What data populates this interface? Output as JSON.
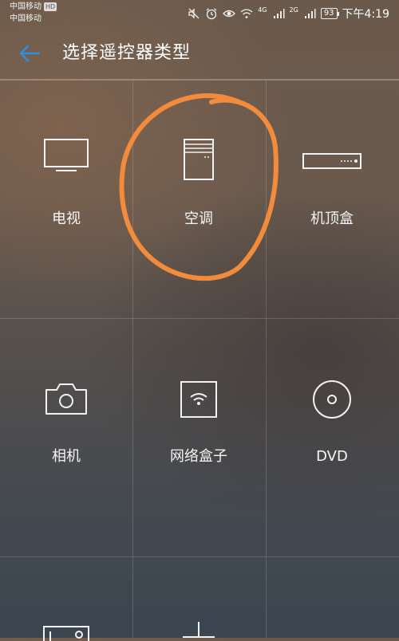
{
  "status_bar": {
    "carrier_1": "中国移动",
    "carrier_1_badge": "HD",
    "carrier_2": "中国移动",
    "network_1": "4G",
    "network_2": "2G",
    "battery": "93",
    "time": "下午4:19",
    "icons": [
      "mute-icon",
      "alarm-icon",
      "eye-icon",
      "wifi-icon",
      "signal-icon",
      "signal-icon",
      "battery-icon"
    ]
  },
  "app_bar": {
    "title": "选择遥控器类型",
    "back_icon": "arrow-left-icon",
    "accent_color": "#2f8fe0"
  },
  "devices": [
    {
      "label": "电视",
      "icon": "tv-icon"
    },
    {
      "label": "空调",
      "icon": "air-conditioner-icon"
    },
    {
      "label": "机顶盒",
      "icon": "set-top-box-icon"
    },
    {
      "label": "相机",
      "icon": "camera-icon"
    },
    {
      "label": "网络盒子",
      "icon": "network-box-icon"
    },
    {
      "label": "DVD",
      "icon": "disc-icon"
    },
    {
      "label": "",
      "icon": "projector-icon"
    },
    {
      "label": "",
      "icon": "fan-icon"
    },
    {
      "label": "",
      "icon": "blank"
    }
  ],
  "annotation": {
    "color": "#f28c3c"
  }
}
